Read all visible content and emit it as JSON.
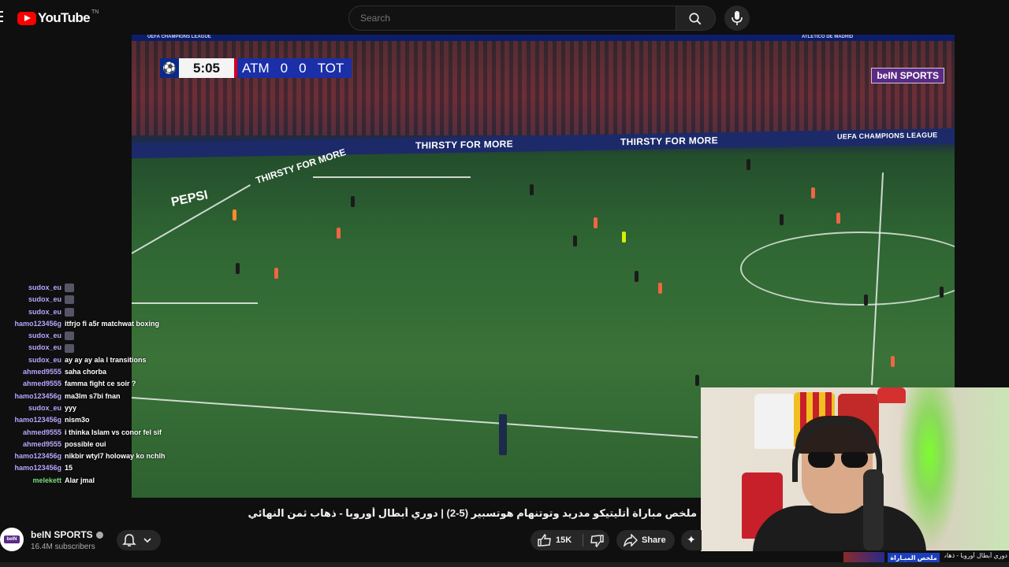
{
  "header": {
    "brand": "YouTube",
    "brand_region": "TN",
    "search_placeholder": "Search",
    "icons": [
      "menu-icon",
      "search-icon",
      "mic-icon"
    ]
  },
  "video": {
    "scoreboard": {
      "time": "5:05",
      "home": "ATM",
      "home_score": "0",
      "away_score": "0",
      "away": "TOT"
    },
    "broadcaster": "beIN SPORTS",
    "top_banner_left": "UEFA CHAMPIONS LEAGUE",
    "top_banner_right": "ATLETICO DE MADRID",
    "boards": [
      "THIRSTY FOR MORE",
      "THIRSTY FOR MORE",
      "UEFA CHAMPIONS LEAGUE",
      "THIRSTY FOR MORE",
      "PEPSI"
    ]
  },
  "chat": [
    {
      "user": "sudox_eu",
      "color": "#b8a5ff",
      "msg": "",
      "emote": true
    },
    {
      "user": "sudox_eu",
      "color": "#b8a5ff",
      "msg": "",
      "emote": true
    },
    {
      "user": "sudox_eu",
      "color": "#b8a5ff",
      "msg": "",
      "emote": true
    },
    {
      "user": "hamo123456g",
      "color": "#b8a5ff",
      "msg": "itfrjo fi a5r matchwat boxing",
      "emote": false
    },
    {
      "user": "sudox_eu",
      "color": "#b8a5ff",
      "msg": "",
      "emote": true
    },
    {
      "user": "sudox_eu",
      "color": "#b8a5ff",
      "msg": "",
      "emote": true
    },
    {
      "user": "sudox_eu",
      "color": "#b8a5ff",
      "msg": "ay ay ay ala l transitions",
      "emote": false
    },
    {
      "user": "ahmed9555",
      "color": "#b8a5ff",
      "msg": "saha chorba",
      "emote": false
    },
    {
      "user": "ahmed9555",
      "color": "#b8a5ff",
      "msg": "famma fight ce soir ?",
      "emote": false
    },
    {
      "user": "hamo123456g",
      "color": "#b8a5ff",
      "msg": "ma3lm s7bi fnan",
      "emote": false
    },
    {
      "user": "sudox_eu",
      "color": "#b8a5ff",
      "msg": "yyy",
      "emote": false
    },
    {
      "user": "hamo123456g",
      "color": "#b8a5ff",
      "msg": "nism3o",
      "emote": false
    },
    {
      "user": "ahmed9555",
      "color": "#b8a5ff",
      "msg": "i thinka Islam vs conor fel sif",
      "emote": false
    },
    {
      "user": "ahmed9555",
      "color": "#b8a5ff",
      "msg": "possible oui",
      "emote": false
    },
    {
      "user": "hamo123456g",
      "color": "#b8a5ff",
      "msg": "nikbir wtyl7 holoway ko nchlh",
      "emote": false
    },
    {
      "user": "hamo123456g",
      "color": "#b8a5ff",
      "msg": "15",
      "emote": false
    },
    {
      "user": "melekett",
      "color": "#7dd97d",
      "msg": "Alar jmal",
      "emote": false
    }
  ],
  "meta": {
    "title": "ملخص مباراة أتليتيكو مدريد وتوتنهام هوتسبير (5-2) | دوري أبطال أوروبا - ذهاب ثمن النهائي",
    "channel_name": "beIN SPORTS",
    "avatar_label": "beIN",
    "subscribers": "16.4M subscribers",
    "likes": "15K",
    "share_label": "Share"
  },
  "overlay": {
    "badge": "ملخص المبـاراة",
    "text": "دوري أبطال أوروبا - ذهاب ثمن النهائي"
  },
  "colors": {
    "brand_red": "#ff0000",
    "bg": "#0f0f0f",
    "chat_name": "#b8a5ff",
    "chat_name_alt": "#7dd97d",
    "bein_purple": "#5b2a86"
  }
}
